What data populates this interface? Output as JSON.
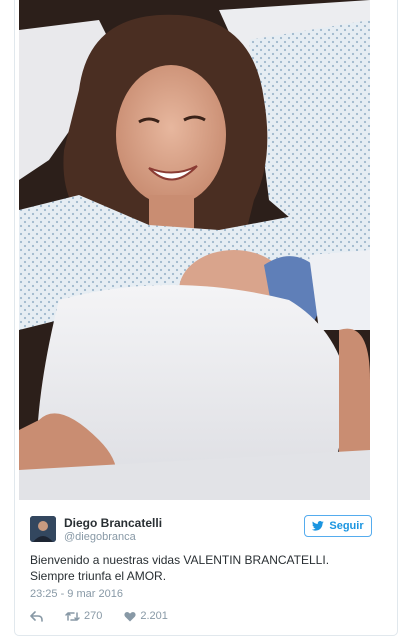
{
  "tweet": {
    "author_name": "Diego Brancatelli",
    "author_handle": "@diegobranca",
    "follow_label": "Seguir",
    "text_line1": "Bienvenido a nuestras vidas VALENTIN BRANCATELLI.",
    "text_line2": "Siempre triunfa el AMOR.",
    "timestamp": "23:25 - 9 mar 2016",
    "retweet_count": "270",
    "like_count": "2.201"
  },
  "icons": {
    "follow": "bird-icon",
    "reply": "reply-icon",
    "retweet": "retweet-icon",
    "like": "heart-icon"
  },
  "colors": {
    "accent": "#1b95e0",
    "muted": "#8899a6",
    "text": "#292f33",
    "border": "#e1e8ed"
  }
}
